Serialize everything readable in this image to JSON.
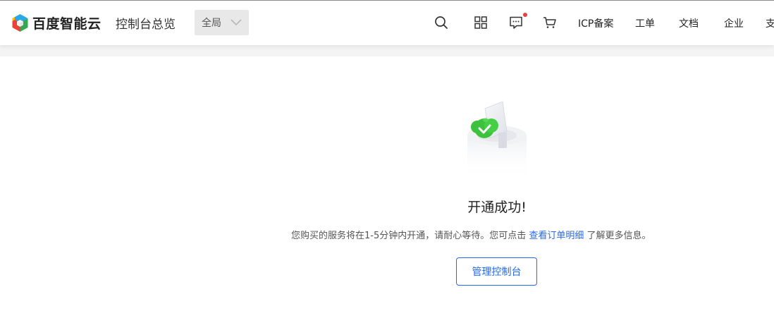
{
  "header": {
    "logo_text": "百度智能云",
    "console_title": "控制台总览",
    "scope_select": {
      "selected": "全局"
    },
    "icons": [
      "search-icon",
      "apps-grid-icon",
      "message-icon",
      "cart-icon"
    ],
    "message_badge_color": "#e8413f",
    "links": [
      "ICP备案",
      "工单",
      "文档",
      "企业",
      "支"
    ]
  },
  "main": {
    "title": "开通成功!",
    "desc_before": "您购买的服务将在1-5分钟内开通，请耐心等待。您可点击",
    "desc_link": "查看订单明细",
    "desc_after": "了解更多信息。",
    "button_label": "管理控制台"
  },
  "colors": {
    "accent": "#2468f2",
    "success_green": "#3cc23c"
  }
}
